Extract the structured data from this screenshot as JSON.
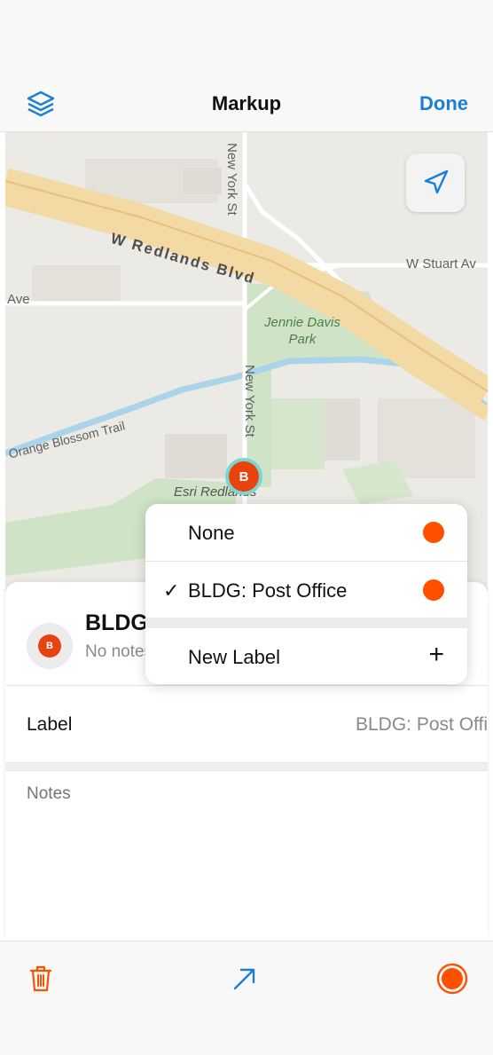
{
  "nav": {
    "title": "Markup",
    "done_label": "Done",
    "layers_icon": "layers-icon"
  },
  "map": {
    "streets": {
      "w_redlands": "W Redlands Blvd",
      "new_york_top": "New York St",
      "new_york_mid": "New York St",
      "w_stuart": "W Stuart Av",
      "ave": "Ave",
      "orange_blossom": "Orange Blossom Trail"
    },
    "places": {
      "park": "Jennie Davis\nPark",
      "esri": "Esri Redlands"
    },
    "pin_letter": "B",
    "locate_icon": "navigation-arrow-icon"
  },
  "sheet": {
    "avatar_letter": "B",
    "title": "BLDG",
    "subtitle": "No notes",
    "label_key": "Label",
    "label_value": "BLDG: Post Offi",
    "notes_placeholder": "Notes"
  },
  "popup": {
    "options": [
      {
        "label": "None",
        "color": "#ff5000",
        "checked": false
      },
      {
        "label": "BLDG: Post Office",
        "color": "#ff5000",
        "checked": true,
        "check_mark": "✓"
      }
    ],
    "new_label": "New Label",
    "plus": "+"
  },
  "toolbar": {
    "delete_icon": "trash-icon",
    "share_icon": "arrow-up-right-icon",
    "color_icon": "record-color-icon"
  },
  "colors": {
    "accent": "#1a7fd4",
    "marker": "#e8430e",
    "swatch": "#ff5000",
    "destructive": "#ff5000"
  }
}
